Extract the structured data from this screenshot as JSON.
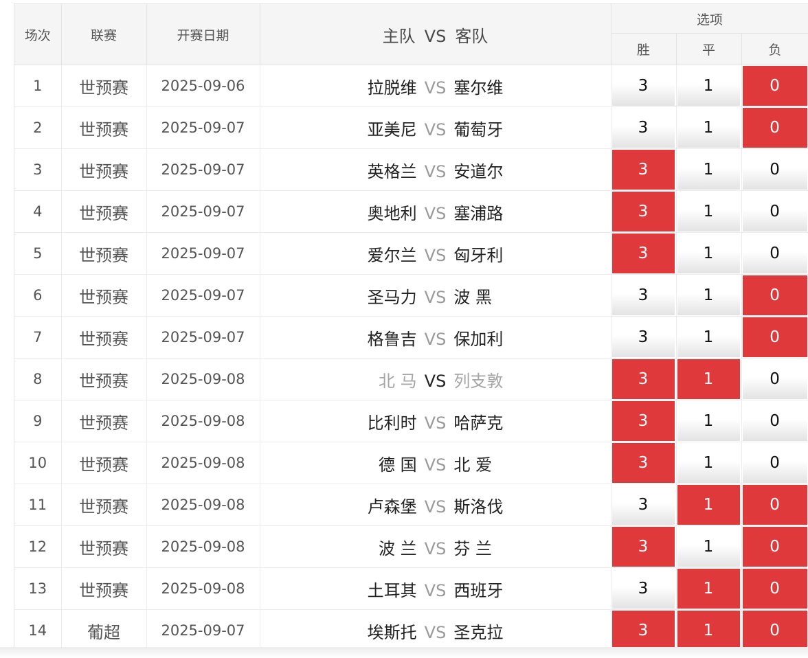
{
  "header": {
    "col_num": "场次",
    "col_league": "联赛",
    "col_date": "开赛日期",
    "col_home": "主队",
    "col_vs": "VS",
    "col_away": "客队",
    "col_options": "选项",
    "opt_win": "胜",
    "opt_draw": "平",
    "opt_lose": "负"
  },
  "colors": {
    "selected": "#e0393c",
    "header_bg": "#f5f5f5"
  },
  "vs_text": "VS",
  "rows": [
    {
      "num": "1",
      "league": "世预赛",
      "date": "2025-09-06",
      "home": "拉脱维",
      "away": "塞尔维",
      "win": "3",
      "draw": "1",
      "lose": "0",
      "sel": [
        false,
        false,
        true
      ],
      "muted": false
    },
    {
      "num": "2",
      "league": "世预赛",
      "date": "2025-09-07",
      "home": "亚美尼",
      "away": "葡萄牙",
      "win": "3",
      "draw": "1",
      "lose": "0",
      "sel": [
        false,
        false,
        true
      ],
      "muted": false
    },
    {
      "num": "3",
      "league": "世预赛",
      "date": "2025-09-07",
      "home": "英格兰",
      "away": "安道尔",
      "win": "3",
      "draw": "1",
      "lose": "0",
      "sel": [
        true,
        false,
        false
      ],
      "muted": false
    },
    {
      "num": "4",
      "league": "世预赛",
      "date": "2025-09-07",
      "home": "奥地利",
      "away": "塞浦路",
      "win": "3",
      "draw": "1",
      "lose": "0",
      "sel": [
        true,
        false,
        false
      ],
      "muted": false
    },
    {
      "num": "5",
      "league": "世预赛",
      "date": "2025-09-07",
      "home": "爱尔兰",
      "away": "匈牙利",
      "win": "3",
      "draw": "1",
      "lose": "0",
      "sel": [
        true,
        false,
        false
      ],
      "muted": false
    },
    {
      "num": "6",
      "league": "世预赛",
      "date": "2025-09-07",
      "home": "圣马力",
      "away": "波 黑",
      "win": "3",
      "draw": "1",
      "lose": "0",
      "sel": [
        false,
        false,
        true
      ],
      "muted": false
    },
    {
      "num": "7",
      "league": "世预赛",
      "date": "2025-09-07",
      "home": "格鲁吉",
      "away": "保加利",
      "win": "3",
      "draw": "1",
      "lose": "0",
      "sel": [
        false,
        false,
        true
      ],
      "muted": false
    },
    {
      "num": "8",
      "league": "世预赛",
      "date": "2025-09-08",
      "home": "北 马",
      "away": "列支敦",
      "win": "3",
      "draw": "1",
      "lose": "0",
      "sel": [
        true,
        true,
        false
      ],
      "muted": true
    },
    {
      "num": "9",
      "league": "世预赛",
      "date": "2025-09-08",
      "home": "比利时",
      "away": "哈萨克",
      "win": "3",
      "draw": "1",
      "lose": "0",
      "sel": [
        true,
        false,
        false
      ],
      "muted": false
    },
    {
      "num": "10",
      "league": "世预赛",
      "date": "2025-09-08",
      "home": "德 国",
      "away": "北 爱",
      "win": "3",
      "draw": "1",
      "lose": "0",
      "sel": [
        true,
        false,
        false
      ],
      "muted": false
    },
    {
      "num": "11",
      "league": "世预赛",
      "date": "2025-09-08",
      "home": "卢森堡",
      "away": "斯洛伐",
      "win": "3",
      "draw": "1",
      "lose": "0",
      "sel": [
        false,
        true,
        true
      ],
      "muted": false
    },
    {
      "num": "12",
      "league": "世预赛",
      "date": "2025-09-08",
      "home": "波 兰",
      "away": "芬 兰",
      "win": "3",
      "draw": "1",
      "lose": "0",
      "sel": [
        true,
        false,
        true
      ],
      "muted": false
    },
    {
      "num": "13",
      "league": "世预赛",
      "date": "2025-09-08",
      "home": "土耳其",
      "away": "西班牙",
      "win": "3",
      "draw": "1",
      "lose": "0",
      "sel": [
        false,
        true,
        true
      ],
      "muted": false
    },
    {
      "num": "14",
      "league": "葡超",
      "date": "2025-09-07",
      "home": "埃斯托",
      "away": "圣克拉",
      "win": "3",
      "draw": "1",
      "lose": "0",
      "sel": [
        true,
        true,
        true
      ],
      "muted": false
    }
  ]
}
